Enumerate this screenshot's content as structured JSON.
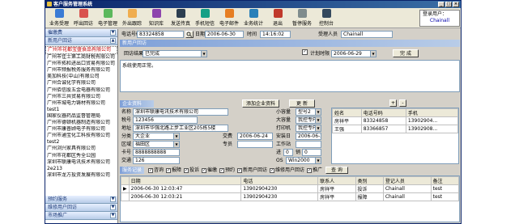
{
  "window": {
    "title": "客户服务管理系统"
  },
  "toolbar": {
    "items": [
      {
        "label": "业务受理",
        "icon": "business-icon",
        "color": "#3a7bd5"
      },
      {
        "label": "呼出回访",
        "icon": "phone-out-icon",
        "color": "#d9534f"
      },
      {
        "label": "电子管理",
        "icon": "computer-icon",
        "color": "#5cb85c"
      },
      {
        "label": "外出跟踪",
        "icon": "car-icon",
        "color": "#f0ad4e"
      },
      {
        "label": "知识库",
        "icon": "book-icon",
        "color": "#8e44ad"
      },
      {
        "label": "发送传真",
        "icon": "fax-icon",
        "color": "#2c3e50"
      },
      {
        "label": "手机短信",
        "icon": "mobile-icon",
        "color": "#16a085"
      },
      {
        "label": "电子邮件",
        "icon": "mail-icon",
        "color": "#e67e22"
      },
      {
        "label": "业务统计",
        "icon": "stats-icon",
        "color": "#2980b9"
      },
      {
        "label": "退出",
        "icon": "exit-icon",
        "color": "#c0392b"
      },
      {
        "label": "暂停服务",
        "icon": "pause-icon",
        "color": "#7f8c8d"
      },
      {
        "label": "控制台",
        "icon": "console-icon",
        "color": "#34495e"
      }
    ],
    "login_label": "登录用户：",
    "login_user": "Chainall"
  },
  "left": {
    "top_header": "催缴费",
    "section_header": "新用户回访",
    "customers": [
      "广州市花都宝盛食品有限公司",
      "广州市佳士第工商财税有限公司",
      "广州市拓和进出口贸易有限公司",
      "广州市频报税务服务有限公司",
      "美加科技(中山)有限公司",
      "广州合诚化学有限公司",
      "广州佰信股五金电器有限公司",
      "广州市三共贸易有限公司",
      "广州市城电力铸材有限公司",
      "test1",
      "国家仪器药品监督管理局",
      "广州市德顿机器制造有限公司",
      "广州市康普顾电子有限公司",
      "广州市通宝化工科技有限公司",
      "test2",
      "广州浏兴家具有限公司",
      "广州市花都区秀全公园",
      "深圳市联康电讯技术有限公司",
      "2e213",
      "深圳市龙方投资发展有限公司"
    ],
    "bottom_headers": [
      "预约服务",
      "维修用户回访",
      "市场推广"
    ]
  },
  "form": {
    "phone_label": "电话号码",
    "phone_value": "83324858",
    "date_label": "日期",
    "date_value": "2006-06-30",
    "time_label": "时间",
    "time_value": "14:16:02",
    "handler_label": "受理人员",
    "handler_value": "Chainall",
    "section_title": "新用户回访",
    "result_label": "回访结果",
    "result_value": "已完成",
    "plan_label": "计划时限",
    "plan_value": "2006-06-29",
    "finish_button": "完 成",
    "memo_text": "系统使用正常。"
  },
  "enterprise": {
    "header": "企业资料",
    "add_button": "添加企业资料",
    "update_button": "更 新",
    "name_label": "名称",
    "name_value": "深圳市联康电讯技术有限公司",
    "tax_label": "税号",
    "tax_value": "123456",
    "address_label": "地址",
    "address_value": "深圳市华强北路上步工业区205栋5楼",
    "category_label": "分类",
    "category_value": "大企业",
    "area_label": "区域",
    "area_value": "福田区",
    "card_label": "卡号",
    "card_value": "8888888888",
    "transit_label": "交通",
    "transit_value": "126",
    "fee_label": "交费",
    "fee_value": "2006-06-24",
    "special_label": "专员",
    "special_value": "",
    "size_label": "小容量",
    "size_value": "型号2",
    "big_label": "大容量",
    "big_value": "我控专F",
    "printer_label": "打印机",
    "printer_value": "我控专F",
    "install_label": "安装日",
    "install_value": "2006-06-24",
    "workstation_label": "工作站",
    "workstation_value": "",
    "in_label": "进",
    "in_value": "0",
    "out_label": "销",
    "out_value": "0",
    "os_label": "OS",
    "os_value": "Win2000"
  },
  "contacts": {
    "add_button": "+",
    "remove_button": "-",
    "columns": [
      "姓名",
      "电话号码",
      "手机"
    ],
    "rows": [
      [
        "房祥平",
        "83324858",
        "13902904..."
      ],
      [
        "王强",
        "83366857",
        "13902908..."
      ]
    ]
  },
  "history": {
    "header": "服务记录",
    "filters": [
      {
        "label": "咨询",
        "checked": true
      },
      {
        "label": "报障",
        "checked": true
      },
      {
        "label": "投诉",
        "checked": true
      },
      {
        "label": "催缴",
        "checked": true
      },
      {
        "label": "预约",
        "checked": true
      },
      {
        "label": "新用户回访",
        "checked": true
      },
      {
        "label": "维修用户回访",
        "checked": true
      },
      {
        "label": "推广",
        "checked": true
      }
    ],
    "query_button": "查 询",
    "columns": [
      "日期",
      "电话",
      "联系人",
      "类别",
      "登记人员",
      "备注"
    ],
    "rows": [
      [
        "2006-06-30 12:03:47",
        "13902904230",
        "房祥平",
        "投诉",
        "Chainall",
        "test"
      ],
      [
        "2006-06-30 12:03:21",
        "13902904230",
        "房祥平",
        "报障",
        "Chainall",
        "test"
      ]
    ]
  }
}
